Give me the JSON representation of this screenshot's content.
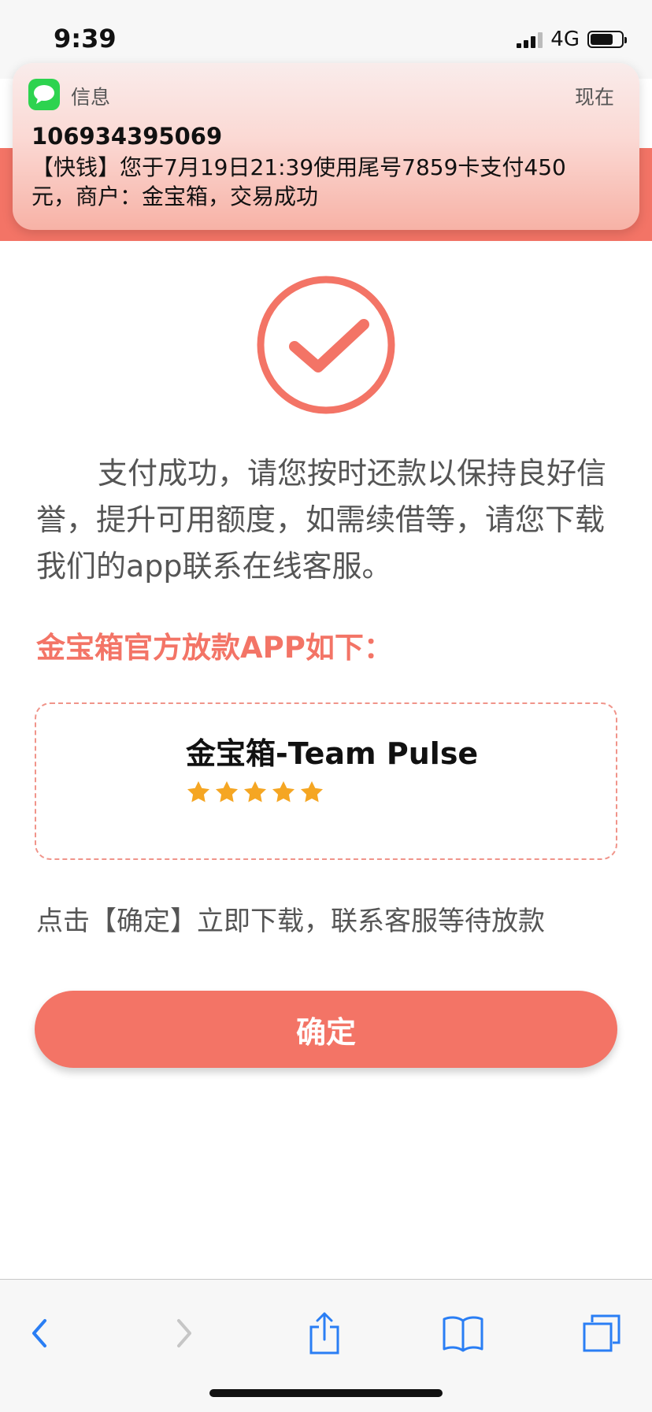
{
  "status_bar": {
    "time": "9:39",
    "network": "4G"
  },
  "notification": {
    "app_name": "信息",
    "time": "现在",
    "sender": "106934395069",
    "body": "【快钱】您于7月19日21:39使用尾号7859卡支付450元，商户：金宝箱，交易成功",
    "icon": "messages-icon",
    "icon_color": "#2dd34f"
  },
  "main": {
    "intro": "支付成功，请您按时还款以保持良好信誉，提升可用额度，如需续借等，请您下载我们的app联系在线客服。",
    "official_heading": "金宝箱官方放款APP如下：",
    "app_card": {
      "name": "金宝箱-Team Pulse",
      "rating": 5,
      "rating_max": 5
    },
    "tip": "点击【确定】立即下载，联系客服等待放款",
    "confirm_label": "确定"
  },
  "colors": {
    "accent": "#f37466",
    "star": "#f5a623",
    "text": "#555555"
  },
  "toolbar": {
    "icons": [
      "back-icon",
      "forward-icon",
      "share-icon",
      "bookmarks-icon",
      "tabs-icon"
    ]
  }
}
